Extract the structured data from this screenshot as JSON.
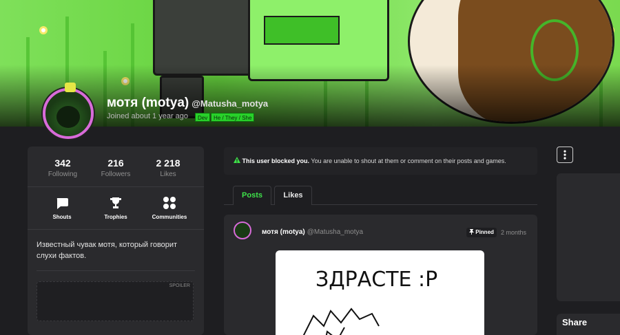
{
  "profile": {
    "display_name": "мотя (motya)",
    "handle": "@Matusha_motya",
    "joined": "Joined about 1 year ago",
    "badges": [
      "Dev",
      "He / They / She"
    ],
    "accent_color": "#28d12a",
    "avatar_ring_color": "#d86bd9"
  },
  "stats": [
    {
      "value": "342",
      "label": "Following"
    },
    {
      "value": "216",
      "label": "Followers"
    },
    {
      "value": "2 218",
      "label": "Likes"
    }
  ],
  "quick_links": [
    {
      "label": "Shouts",
      "icon": "speech-bubble-icon"
    },
    {
      "label": "Trophies",
      "icon": "trophy-icon"
    },
    {
      "label": "Communities",
      "icon": "communities-icon"
    }
  ],
  "bio": "Известный чувак мотя, который говорит слухи фактов.",
  "spoiler_label": "SPOILER",
  "notice": {
    "icon": "warning-icon",
    "bold": "This user blocked you.",
    "text": "You are unable to shout at them or comment on their posts and games."
  },
  "tabs": [
    {
      "label": "Posts",
      "active": true
    },
    {
      "label": "Likes",
      "active": false
    }
  ],
  "post": {
    "author": "мотя (motya)",
    "handle": "@Matusha_motya",
    "pinned_label": "Pinned",
    "time": "2 months",
    "image_text": "ЗДРАСТЕ :Р"
  },
  "sidebar": {
    "menu_icon": "more-vertical-icon",
    "share_label": "Share"
  }
}
